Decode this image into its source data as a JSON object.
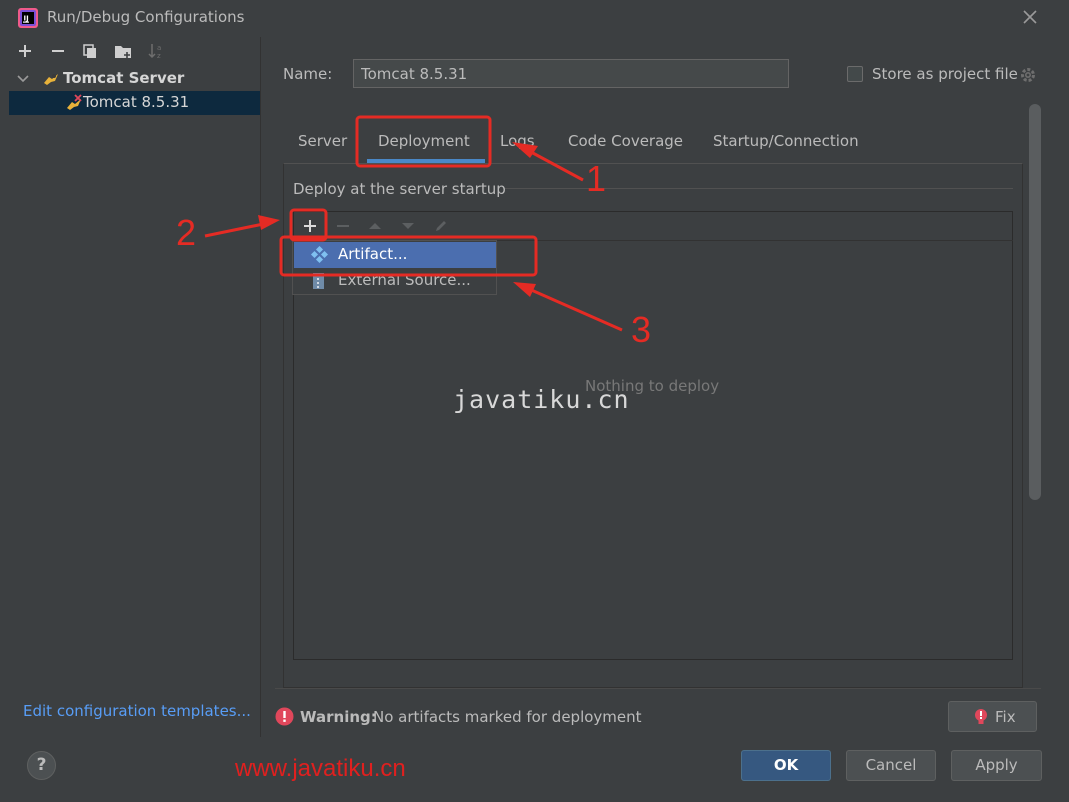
{
  "window": {
    "title": "Run/Debug Configurations"
  },
  "sidebar": {
    "tree": [
      {
        "label": "Tomcat Server",
        "expanded": true
      },
      {
        "label": "Tomcat 8.5.31",
        "selected": true
      }
    ],
    "edit_templates_link": "Edit configuration templates..."
  },
  "config": {
    "name_label": "Name:",
    "name_value": "Tomcat 8.5.31",
    "store_label": "Store as project file",
    "store_checked": false
  },
  "tabs": [
    {
      "label": "Server"
    },
    {
      "label": "Deployment",
      "active": true
    },
    {
      "label": "Logs"
    },
    {
      "label": "Code Coverage"
    },
    {
      "label": "Startup/Connection"
    }
  ],
  "deployment": {
    "heading": "Deploy at the server startup",
    "empty_text": "Nothing to deploy",
    "menu": [
      {
        "label": "Artifact...",
        "highlighted": true
      },
      {
        "label": "External Source..."
      }
    ]
  },
  "warning": {
    "strong": "Warning:",
    "text": "No artifacts marked for deployment",
    "fix_label": "Fix"
  },
  "buttons": {
    "help": "?",
    "ok": "OK",
    "cancel": "Cancel",
    "apply": "Apply"
  },
  "watermarks": {
    "center": "javatiku.cn",
    "url": "www.javatiku.cn"
  },
  "annotations": {
    "one": "1",
    "two": "2",
    "three": "3"
  },
  "colors": {
    "background": "#3c3f41",
    "selection": "#0d293e",
    "menu_highlight": "#4b6eaf",
    "link": "#589df6",
    "annotation_red": "#e52b24",
    "ok_button": "#365880"
  }
}
